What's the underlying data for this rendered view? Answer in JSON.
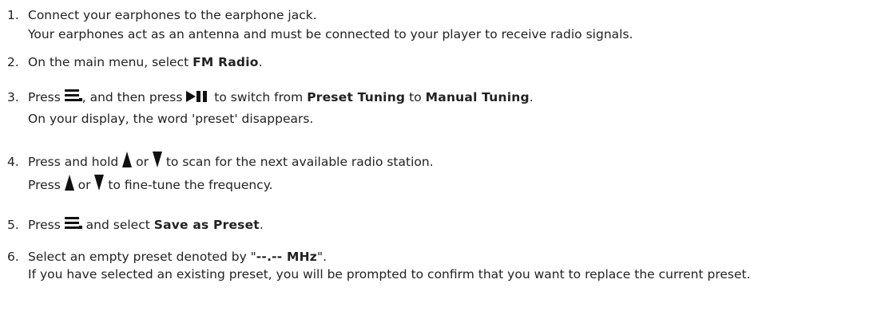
{
  "steps": [
    {
      "number": "1.",
      "line1": "Connect your earphones to the earphone jack.",
      "line2": "Your earphones act as an antenna and must be connected to your player to receive radio signals."
    },
    {
      "number": "2.",
      "pre": "On the main menu, select ",
      "bold": "FM Radio",
      "post": "."
    },
    {
      "number": "3.",
      "pre": "Press ",
      "icon1": "menu-icon",
      "mid1": ", and then press ",
      "icon2": "play-pause-icon",
      "mid2": " to switch from ",
      "bold1": "Preset Tuning",
      "mid3": " to ",
      "bold2": "Manual Tuning",
      "post": ".",
      "line2": "On your display, the word 'preset' disappears."
    },
    {
      "number": "4.",
      "line1_pre": "Press and hold ",
      "line1_or": " or ",
      "line1_post": " to scan for the next available radio station.",
      "line2_pre": "Press ",
      "line2_or": " or ",
      "line2_post": " to fine-tune the frequency.",
      "icon_up": "up-arrow-icon",
      "icon_down": "down-arrow-icon"
    },
    {
      "number": "5.",
      "pre": "Press ",
      "icon": "menu-icon",
      "mid": " and select ",
      "bold": "Save as Preset",
      "post": "."
    },
    {
      "number": "6.",
      "pre": "Select an empty preset denoted by \"",
      "bold": "--.-- MHz",
      "post": "\".",
      "line2": "If you have selected an existing preset, you will be prompted to confirm that you want to replace the current preset."
    }
  ]
}
